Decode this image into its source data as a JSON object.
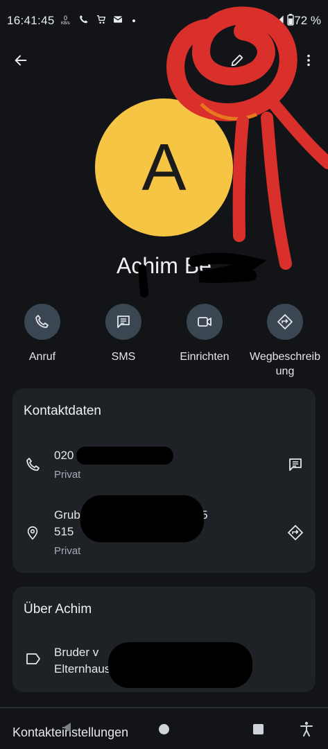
{
  "status_bar": {
    "time": "16:41:45",
    "net_speed": "0",
    "net_unit": "KB/s",
    "battery": "72 %"
  },
  "contact": {
    "initial": "A",
    "name_visible": "Achim Be"
  },
  "actions": [
    {
      "label": "Anruf",
      "icon": "phone-icon"
    },
    {
      "label": "SMS",
      "icon": "message-icon"
    },
    {
      "label": "Einrichten",
      "icon": "video-icon"
    },
    {
      "label": "Wegbeschreibung",
      "icon": "directions-icon"
    }
  ],
  "contact_card": {
    "title": "Kontaktdaten",
    "phone": {
      "value": "020",
      "type": "Privat"
    },
    "address": {
      "line1": "Grub",
      "line1_end": "4 5",
      "line2": "515",
      "type": "Privat"
    }
  },
  "about_card": {
    "title": "Über Achim",
    "text_line1": "Bruder v",
    "text_line2": "Elternhaus"
  },
  "bottom": {
    "label": "Kontakteinstellungen"
  },
  "colors": {
    "background": "#121418",
    "card": "#1e2126",
    "avatar": "#f6c543",
    "action_circle": "#3a4752",
    "annotation_red": "#d9302c"
  }
}
